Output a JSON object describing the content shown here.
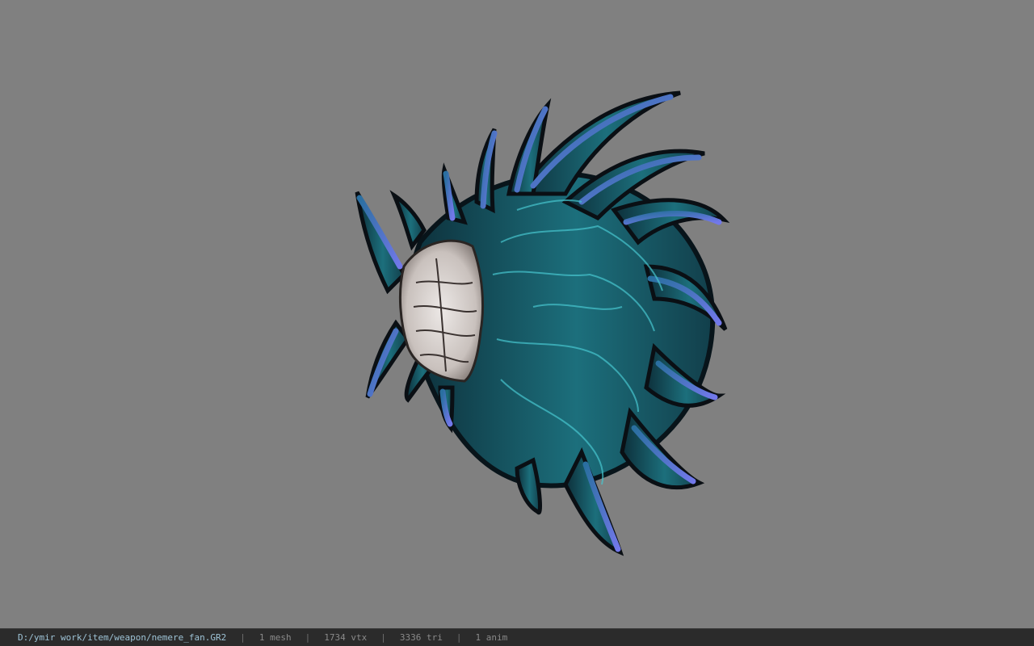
{
  "viewer": {
    "background_color": "#808080",
    "model_name": "nemere_fan",
    "model_palette": {
      "blade_dark": "#0f3a44",
      "blade_teal": "#1f7f8c",
      "blade_cyan": "#3fb9c4",
      "edge_violet": "#6a6ee0",
      "outline": "#0a0f14",
      "handle": "#d8d2cf"
    }
  },
  "status": {
    "file_path": "D:/ymir work/item/weapon/nemere_fan.GR2",
    "separator": "|",
    "mesh_count": "1 mesh",
    "vertex_count": "1734 vtx",
    "triangle_count": "3336 tri",
    "anim_count": "1 anim"
  }
}
